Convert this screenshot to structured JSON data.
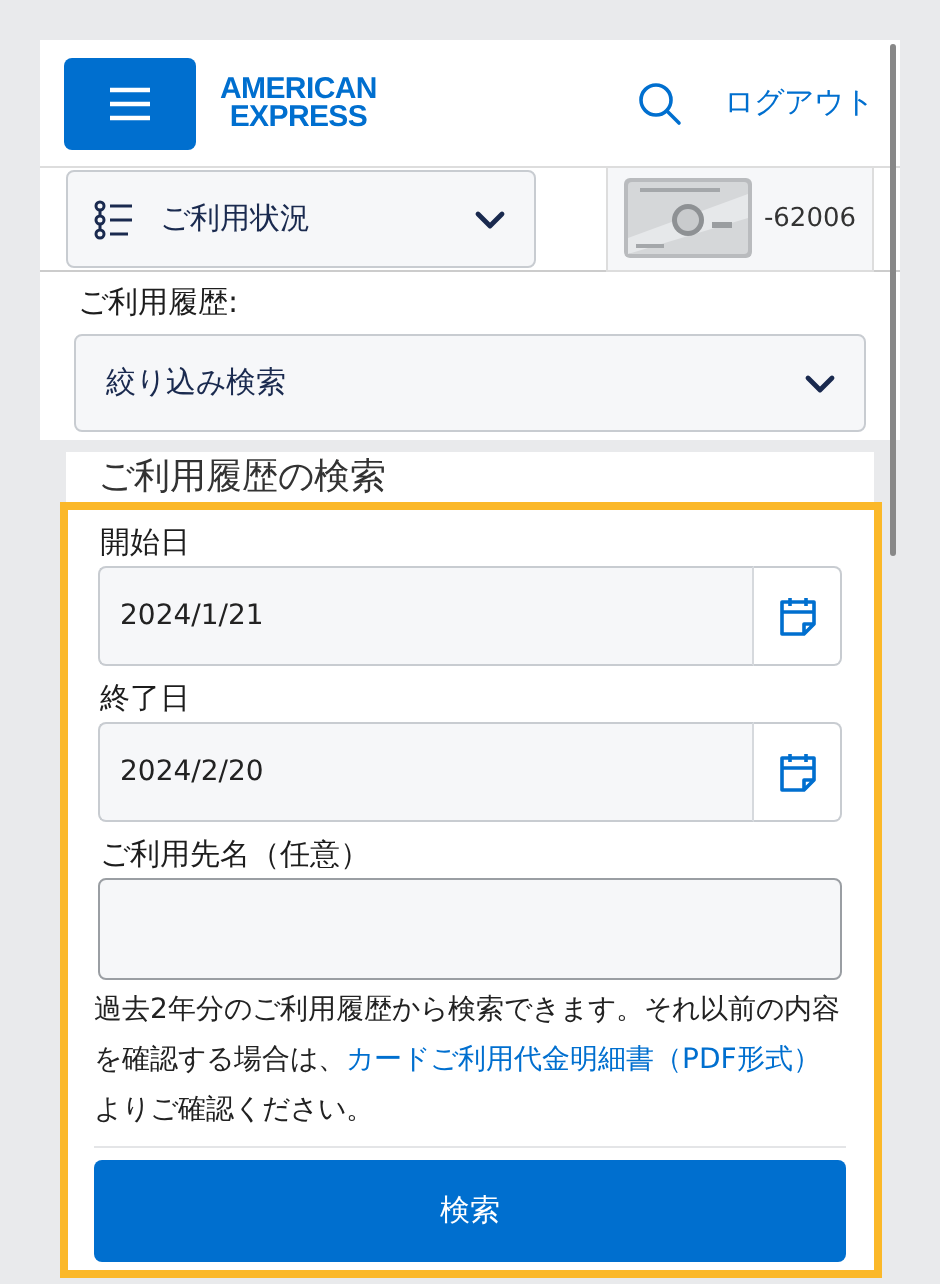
{
  "header": {
    "logo": [
      "AMERICAN",
      "EXPRESS"
    ],
    "logout": "ログアウト"
  },
  "account_bar": {
    "menu": "ご利用状況",
    "card_number": "-62006"
  },
  "history": {
    "label": "ご利用履歴:",
    "filter": "絞り込み検索"
  },
  "search_form": {
    "title": "ご利用履歴の検索",
    "fields": [
      {
        "kind": "date",
        "label": "開始日",
        "value": "2024/1/21"
      },
      {
        "kind": "date",
        "label": "終了日",
        "value": "2024/2/20"
      },
      {
        "kind": "text",
        "label": "ご利用先名（任意）"
      }
    ],
    "note": {
      "before": "過去2年分のご利用履歴から検索できます。それ以前の内容を確認する場合は、",
      "link": "カードご利用代金明細書（PDF形式）",
      "after": " よりご確認ください。"
    },
    "submit": "検索"
  }
}
